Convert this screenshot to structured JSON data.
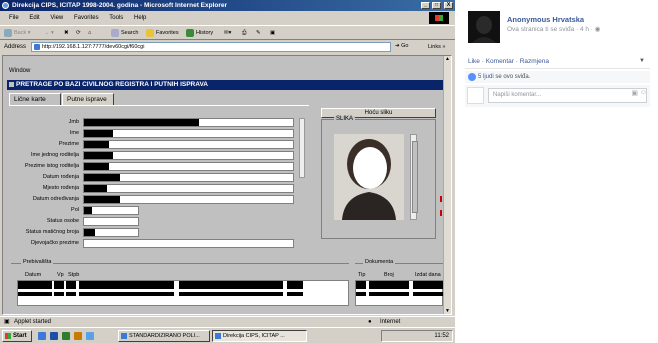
{
  "browser": {
    "title": "Direkcija CIPS, ICITAP 1998-2004. godina - Microsoft Internet Explorer",
    "window_buttons": [
      "_",
      "□",
      "X"
    ],
    "menu": [
      "File",
      "Edit",
      "View",
      "Favorites",
      "Tools",
      "Help"
    ],
    "toolbar": {
      "back": "Back",
      "search": "Search",
      "favorites": "Favorites",
      "history": "History"
    },
    "address_label": "Address",
    "address": "http://192.168.1.127:7777/dev60cgi/f60cgi",
    "go": "Go",
    "links": "Links"
  },
  "app": {
    "window_label": "Window",
    "form_title": "PRETRAGE PO BAZI CIVILNOG REGISTRA I PUTNIH ISPRAVA",
    "tabs": [
      "Lične karte",
      "Putne isprave"
    ],
    "fields": [
      {
        "label": "Jmb",
        "redacted": 0.55
      },
      {
        "label": "Ime",
        "redacted": 0.14
      },
      {
        "label": "Prezime",
        "redacted": 0.12
      },
      {
        "label": "Ime jednog roditelja",
        "redacted": 0.14
      },
      {
        "label": "Prezime istog roditelja",
        "redacted": 0.12
      },
      {
        "label": "Datum rođenja",
        "redacted": 0.17
      },
      {
        "label": "Mjesto rođenja",
        "redacted": 0.11
      },
      {
        "label": "Datum određivanja",
        "redacted": 0.17
      },
      {
        "label": "Pol",
        "redacted": 0.15
      },
      {
        "label": "Status osobe",
        "redacted": 0.0
      },
      {
        "label": "Status matičnog broja",
        "redacted": 0.2
      },
      {
        "label": "Djevojačko prezime",
        "redacted": 0.0
      }
    ],
    "photo_button": "Hoću sliku",
    "photo_label": "SLIKA",
    "residence_section": "Prebivališta",
    "residence_headers": [
      "Datum",
      "Vp",
      "Stpb"
    ],
    "documents_section": "Dokumenta",
    "documents_headers": [
      "Tip",
      "Broj",
      "Izdat dana"
    ]
  },
  "status": {
    "text": "Applet started",
    "zone": "Internet"
  },
  "taskbar": {
    "start": "Start",
    "items": [
      "STANDARDIZIRANO POLI...",
      "Direkcija CIPS, ICITAP ..."
    ],
    "clock": "11:52"
  },
  "facebook": {
    "page_name": "Anonymous Hrvatska",
    "subtitle": "Ova stranica ti se sviđa · 4 h ·",
    "actions": [
      "Like",
      "Komentar",
      "Razmjena"
    ],
    "likes_count": "5 ljudi",
    "likes_suffix": " se ovo sviđa.",
    "comment_placeholder": "Napiši komentar..."
  }
}
